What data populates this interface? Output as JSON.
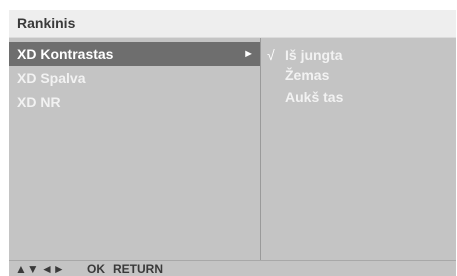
{
  "header": {
    "title": "Rankinis"
  },
  "menu": {
    "items": [
      {
        "label": "XD Kontrastas",
        "selected": true,
        "arrow": "►"
      },
      {
        "label": "XD Spalva",
        "selected": false
      },
      {
        "label": "XD NR",
        "selected": false
      }
    ]
  },
  "options": {
    "check_mark": "√",
    "items": [
      {
        "label": "Iš jungta",
        "checked": true
      },
      {
        "label": "Žemas",
        "checked": false
      },
      {
        "label": "Aukš tas",
        "checked": false
      }
    ]
  },
  "footer": {
    "updown_icon": "▲▼",
    "leftright_icon": "◄►",
    "ok_label": "OK",
    "return_label": "RETURN"
  },
  "colors": {
    "panel_bg": "#c4c4c4",
    "selected_bg": "#6e6e6e",
    "title_bg": "#eeeeee",
    "text_light": "#f2f2f2",
    "text_dark": "#3a3a3a"
  }
}
